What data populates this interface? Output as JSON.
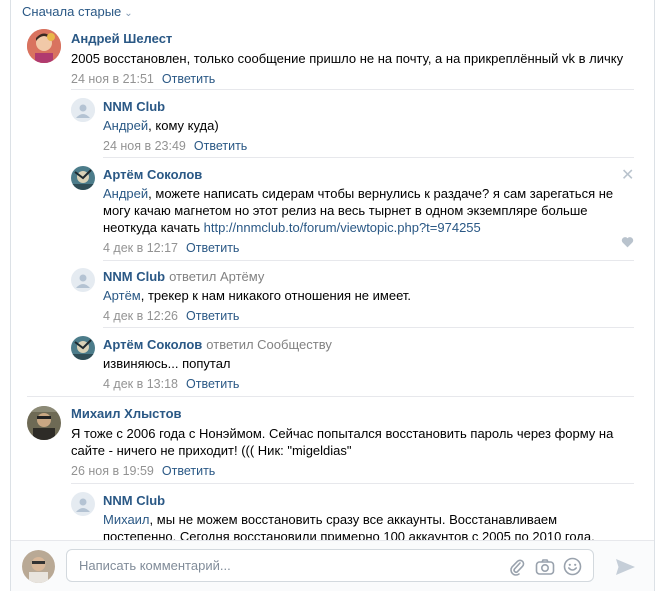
{
  "sort": {
    "label": "Сначала старые"
  },
  "comments": [
    {
      "author": "Андрей Шелест",
      "text": "2005 восстановлен, только сообщение пришло не на почту, а на прикреплённый vk в личку",
      "date": "24 ноя в 21:51",
      "reply_label": "Ответить"
    },
    {
      "author": "NNM Club",
      "mention": "Андрей",
      "text": ", кому куда)",
      "date": "24 ноя в 23:49",
      "reply_label": "Ответить"
    },
    {
      "author": "Артём Соколов",
      "mention": "Андрей",
      "text_line1": ", можете написать сидерам чтобы вернулись к раздаче? я сам зарегаться не",
      "text_line2": "могу качаю магнетом но этот релиз на весь тырнет в одном экземпляре больше",
      "text_line3": "неоткуда качать ",
      "link": "http://nnmclub.to/forum/viewtopic.php?t=974255",
      "date": "4 дек в 12:17",
      "reply_label": "Ответить"
    },
    {
      "author": "NNM Club",
      "replied_to": "ответил Артёму",
      "mention": "Артём",
      "text": ", трекер к нам никакого отношения не имеет.",
      "date": "4 дек в 12:26",
      "reply_label": "Ответить"
    },
    {
      "author": "Артём Соколов",
      "replied_to": "ответил Сообществу",
      "text": "извиняюсь... попутал",
      "date": "4 дек в 13:18",
      "reply_label": "Ответить"
    },
    {
      "author": "Михаил Хлыстов",
      "text_line1": "Я тоже с 2006 года с Нонэймом. Сейчас попытался восстановить пароль через форму на",
      "text_line2": "сайте - ничего не приходит! ((( Ник: \"migeldias\"",
      "date": "26 ноя в 19:59",
      "reply_label": "Ответить"
    },
    {
      "author": "NNM Club",
      "mention": "Михаил",
      "text_line1": ", мы не можем восстановить сразу все аккаунты. Восстанавливаем",
      "text_line2": "постепенно. Сегодня восстановили примерно 100 аккаунтов с 2005 по 2010 года."
    }
  ],
  "composer": {
    "placeholder": "Написать комментарий..."
  },
  "colors": {
    "link": "#2a5885",
    "muted": "#939393",
    "accent": "#5181b8"
  }
}
